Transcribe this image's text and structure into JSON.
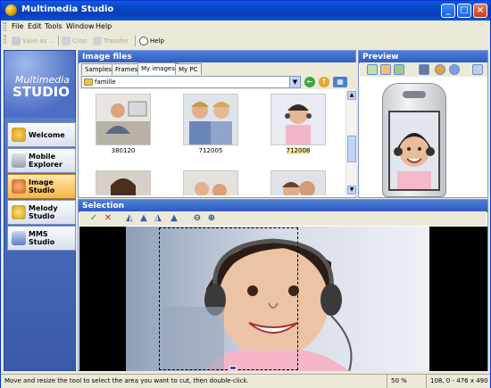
{
  "window": {
    "title": "Multimedia Studio"
  },
  "menu": [
    "File",
    "Edit",
    "Tools",
    "Window",
    "Help"
  ],
  "toolbar": {
    "save_as": "Save as ...",
    "crop": "Crop",
    "transfer": "Transfer",
    "help": "Help"
  },
  "sidebar": {
    "logo_line1": "Multimedia",
    "logo_line2": "STUDIO",
    "items": [
      {
        "label": "Welcome",
        "icon": "welcome-note-icon"
      },
      {
        "label": "Mobile Explorer",
        "icon": "phone-icon"
      },
      {
        "label": "Image Studio",
        "icon": "image-studio-icon",
        "active": true
      },
      {
        "label": "Melody Studio",
        "icon": "music-note-icon"
      },
      {
        "label": "MMS Studio",
        "icon": "mms-icon"
      }
    ]
  },
  "image_files": {
    "header": "Image files",
    "tabs": [
      "Samples",
      "Frames",
      "My images",
      "My PC"
    ],
    "active_tab": "My images",
    "folder": "famille",
    "thumbnails": [
      {
        "label": "380120"
      },
      {
        "label": "712005"
      },
      {
        "label": "712008",
        "selected": true
      },
      {
        "label": ""
      },
      {
        "label": ""
      },
      {
        "label": ""
      }
    ]
  },
  "preview": {
    "header": "Preview"
  },
  "selection": {
    "header": "Selection"
  },
  "status": {
    "message": "Move and resize the tool to select the area you want to cut, then double-click.",
    "zoom": "50 %",
    "coords": "108, 0 - 476 x 490"
  },
  "colors": {
    "accent": "#2c5ac0",
    "selected_tab": "#f6b54a"
  }
}
